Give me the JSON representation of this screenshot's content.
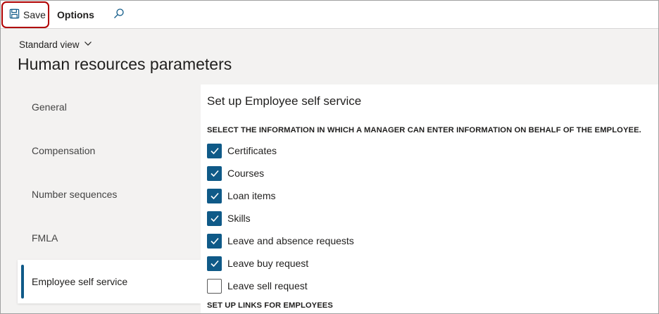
{
  "toolbar": {
    "save_label": "Save",
    "options_label": "Options",
    "search_icon": "search-icon",
    "save_icon": "floppy-disk-icon"
  },
  "header": {
    "view_label": "Standard view",
    "page_title": "Human resources parameters"
  },
  "nav": {
    "items": [
      {
        "label": "General",
        "selected": false
      },
      {
        "label": "Compensation",
        "selected": false
      },
      {
        "label": "Number sequences",
        "selected": false
      },
      {
        "label": "FMLA",
        "selected": false
      },
      {
        "label": "Employee self service",
        "selected": true
      }
    ]
  },
  "panel": {
    "title": "Set up Employee self service",
    "section1": "SELECT THE INFORMATION IN WHICH A MANAGER CAN ENTER INFORMATION ON BEHALF OF THE EMPLOYEE.",
    "checkboxes": [
      {
        "label": "Certificates",
        "checked": true
      },
      {
        "label": "Courses",
        "checked": true
      },
      {
        "label": "Loan items",
        "checked": true
      },
      {
        "label": "Skills",
        "checked": true
      },
      {
        "label": "Leave and absence requests",
        "checked": true
      },
      {
        "label": "Leave buy request",
        "checked": true
      },
      {
        "label": "Leave sell request",
        "checked": false
      }
    ],
    "section2": "SET UP LINKS FOR EMPLOYEES"
  },
  "colors": {
    "accent": "#0f5a88",
    "highlight_border": "#b00000",
    "background": "#f3f2f1"
  }
}
